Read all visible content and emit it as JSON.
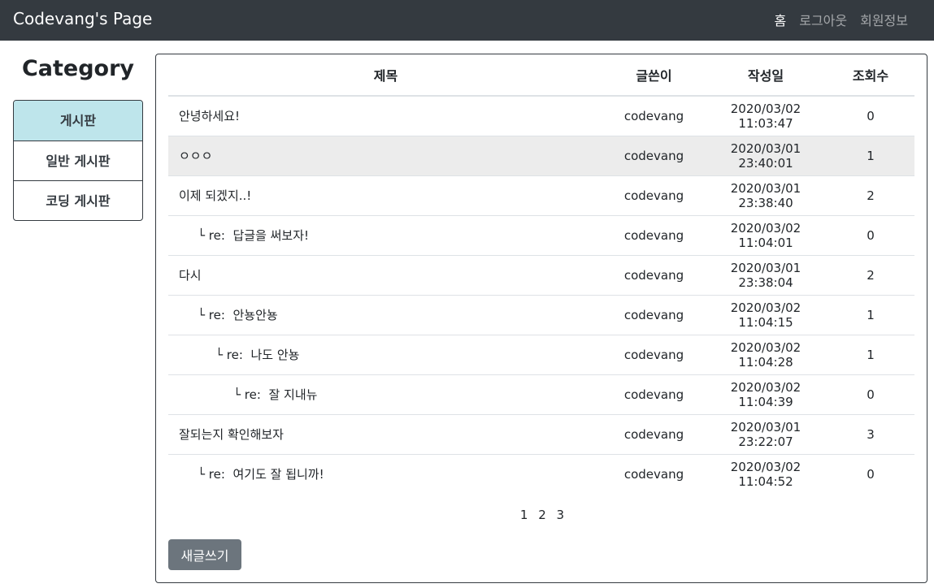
{
  "navbar": {
    "brand": "Codevang's Page",
    "links": [
      {
        "label": "홈"
      },
      {
        "label": "로그아웃"
      },
      {
        "label": "회원정보"
      }
    ]
  },
  "sidebar": {
    "title": "Category",
    "items": [
      {
        "label": "게시판"
      },
      {
        "label": "일반 게시판"
      },
      {
        "label": "코딩 게시판"
      }
    ]
  },
  "board": {
    "headers": {
      "title": "제목",
      "writer": "글쓴이",
      "date": "작성일",
      "views": "조회수"
    },
    "reply_prefix": "└ re:",
    "rows": [
      {
        "title": "안녕하세요!",
        "writer": "codevang",
        "date": "2020/03/02 11:03:47",
        "views": "0"
      },
      {
        "title": "ㅇㅇㅇ",
        "writer": "codevang",
        "date": "2020/03/01 23:40:01",
        "views": "1"
      },
      {
        "title": "이제 되겠지..!",
        "writer": "codevang",
        "date": "2020/03/01 23:38:40",
        "views": "2"
      },
      {
        "title": "답글을 써보자!",
        "writer": "codevang",
        "date": "2020/03/02 11:04:01",
        "views": "0"
      },
      {
        "title": "다시",
        "writer": "codevang",
        "date": "2020/03/01 23:38:04",
        "views": "2"
      },
      {
        "title": "안뇽안뇽",
        "writer": "codevang",
        "date": "2020/03/02 11:04:15",
        "views": "1"
      },
      {
        "title": "나도 안뇽",
        "writer": "codevang",
        "date": "2020/03/02 11:04:28",
        "views": "1"
      },
      {
        "title": "잘 지내뉴",
        "writer": "codevang",
        "date": "2020/03/02 11:04:39",
        "views": "0"
      },
      {
        "title": "잘되는지 확인해보자",
        "writer": "codevang",
        "date": "2020/03/01 23:22:07",
        "views": "3"
      },
      {
        "title": "여기도 잘 됩니까!",
        "writer": "codevang",
        "date": "2020/03/02 11:04:52",
        "views": "0"
      }
    ]
  },
  "pagination": {
    "pages": [
      "1",
      "2",
      "3"
    ]
  },
  "write_button": "새글쓰기"
}
